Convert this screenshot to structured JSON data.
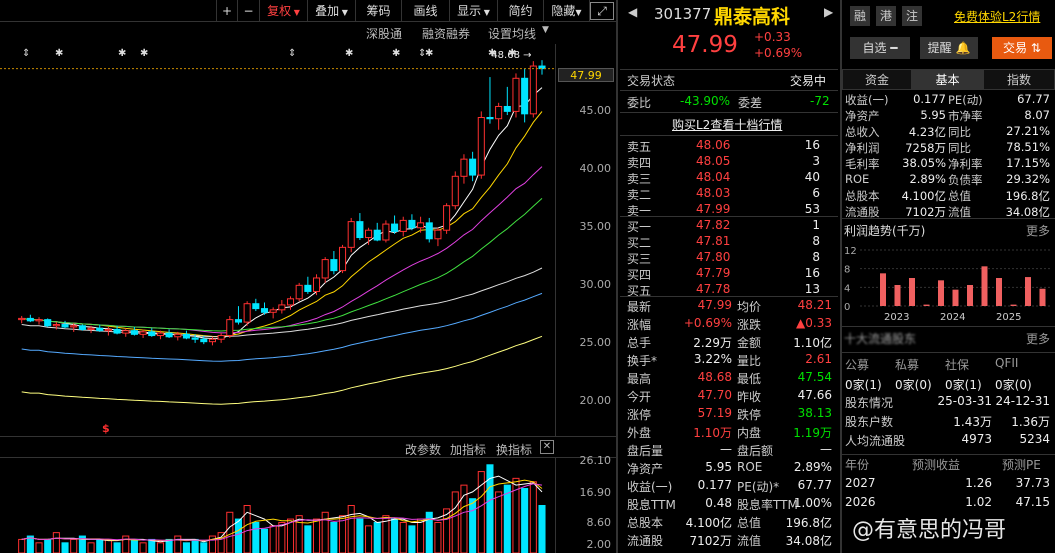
{
  "toolbar": {
    "plus": "+",
    "minus": "−",
    "fq": "复权",
    "overlay": "叠加",
    "chips": "筹码",
    "draw": "画线",
    "show": "显示",
    "simple": "简约",
    "hide": "隐藏",
    "expand": "⤢"
  },
  "chart_tabs": {
    "sgt": "深股通",
    "rzrq": "融资融券",
    "setma": "设置均线"
  },
  "indicator_tabs": {
    "params": "改参数",
    "add": "加指标",
    "change": "换指标"
  },
  "price_axis": [
    "45.00",
    "40.00",
    "35.00",
    "30.00",
    "25.00",
    "20.00"
  ],
  "current_price_tag": "47.99",
  "high_marker": "48.68",
  "vol_axis": [
    "26.10",
    "16.90",
    "8.60",
    "2.00"
  ],
  "header": {
    "code": "301377",
    "name": "鼎泰高科",
    "price": "47.99",
    "change": "+0.33",
    "pct": "+0.69%",
    "tags": [
      "融",
      "港",
      "注"
    ],
    "l2_link": "免费体验L2行情",
    "zixuan": "自选",
    "remind": "提醒",
    "trade": "交易"
  },
  "status": {
    "label": "交易状态",
    "value": "交易中"
  },
  "weibi": {
    "label": "委比",
    "value": "-43.90%",
    "label2": "委差",
    "value2": "-72"
  },
  "l2_buy": "购买L2查看十档行情",
  "asks": [
    {
      "n": "卖五",
      "p": "48.06",
      "v": "16"
    },
    {
      "n": "卖四",
      "p": "48.05",
      "v": "3"
    },
    {
      "n": "卖三",
      "p": "48.04",
      "v": "40"
    },
    {
      "n": "卖二",
      "p": "48.03",
      "v": "6"
    },
    {
      "n": "卖一",
      "p": "47.99",
      "v": "53"
    }
  ],
  "bids": [
    {
      "n": "买一",
      "p": "47.82",
      "v": "1"
    },
    {
      "n": "买二",
      "p": "47.81",
      "v": "8"
    },
    {
      "n": "买三",
      "p": "47.80",
      "v": "8"
    },
    {
      "n": "买四",
      "p": "47.79",
      "v": "16"
    },
    {
      "n": "买五",
      "p": "47.78",
      "v": "13"
    }
  ],
  "quote": [
    [
      "最新",
      "47.99",
      "均价",
      "48.21"
    ],
    [
      "涨幅",
      "+0.69%",
      "涨跌",
      "▲0.33"
    ],
    [
      "总手",
      "2.29万",
      "金额",
      "1.10亿"
    ],
    [
      "换手*",
      "3.22%",
      "量比",
      "2.61"
    ],
    [
      "最高",
      "48.68",
      "最低",
      "47.54"
    ],
    [
      "今开",
      "47.70",
      "昨收",
      "47.66"
    ],
    [
      "涨停",
      "57.19",
      "跌停",
      "38.13"
    ],
    [
      "外盘",
      "1.10万",
      "内盘",
      "1.19万"
    ],
    [
      "盘后量",
      "—",
      "盘后额",
      "—"
    ],
    [
      "净资产",
      "5.95",
      "ROE",
      "2.89%"
    ],
    [
      "收益(一)",
      "0.177",
      "PE(动)*",
      "67.77"
    ],
    [
      "股息TTM",
      "0.48",
      "股息率TTM",
      "1.00%"
    ],
    [
      "总股本",
      "4.100亿",
      "总值",
      "196.8亿"
    ],
    [
      "流通股",
      "7102万",
      "流值",
      "34.08亿"
    ]
  ],
  "rtabs": [
    "资金",
    "基本",
    "指数"
  ],
  "fund": [
    [
      "收益(一)",
      "0.177",
      "PE(动)",
      "67.77"
    ],
    [
      "净资产",
      "5.95",
      "市净率",
      "8.07"
    ],
    [
      "总收入",
      "4.23亿",
      "同比",
      "27.21%"
    ],
    [
      "净利润",
      "7258万",
      "同比",
      "78.51%"
    ],
    [
      "毛利率",
      "38.05%",
      "净利率",
      "17.15%"
    ],
    [
      "ROE",
      "2.89%",
      "负债率",
      "29.32%"
    ],
    [
      "总股本",
      "4.100亿",
      "总值",
      "196.8亿"
    ],
    [
      "流通股",
      "7102万",
      "流值",
      "34.08亿"
    ]
  ],
  "profit": {
    "title": "利润趋势(千万)",
    "more": "更多",
    "yticks": [
      "12",
      "8",
      "4",
      "0"
    ],
    "years": [
      "2023",
      "2024",
      "2025"
    ],
    "values": [
      7,
      4.5,
      6,
      0.3,
      5.5,
      3.5,
      4.5,
      8.5,
      6,
      0.3,
      6.2,
      3.7
    ]
  },
  "holders": {
    "title": "十大流通股东",
    "more": "更多",
    "cols": [
      "公募",
      "私募",
      "社保",
      "QFII"
    ],
    "vals": [
      "0家(1)",
      "0家(0)",
      "0家(1)",
      "0家(0)"
    ],
    "rows": [
      [
        "股东情况",
        "25-03-31",
        "24-12-31"
      ],
      [
        "股东户数",
        "1.43万",
        "1.36万"
      ],
      [
        "人均流通股",
        "4973",
        "5234"
      ]
    ]
  },
  "forecast": {
    "cols": [
      "年份",
      "预测收益",
      "预测PE"
    ],
    "rows": [
      [
        "2027",
        "1.26",
        "37.73"
      ],
      [
        "2026",
        "1.02",
        "47.15"
      ]
    ]
  },
  "watermark": "@有意思的冯哥",
  "chart_data": {
    "type": "candlestick",
    "ylim": [
      18,
      50
    ],
    "last_price": 47.99,
    "high": 48.68,
    "candles": [
      [
        27.5,
        27.8,
        27.2,
        27.6
      ],
      [
        27.6,
        27.9,
        27.3,
        27.4
      ],
      [
        27.4,
        27.7,
        27.1,
        27.5
      ],
      [
        27.5,
        27.6,
        26.9,
        27.0
      ],
      [
        27.0,
        27.3,
        26.7,
        27.1
      ],
      [
        27.1,
        27.4,
        26.8,
        26.9
      ],
      [
        26.9,
        27.2,
        26.5,
        27.0
      ],
      [
        27.0,
        27.1,
        26.6,
        26.7
      ],
      [
        26.7,
        27.0,
        26.4,
        26.8
      ],
      [
        26.8,
        27.1,
        26.5,
        26.6
      ],
      [
        26.6,
        26.9,
        26.2,
        26.7
      ],
      [
        26.7,
        27.0,
        26.3,
        26.4
      ],
      [
        26.4,
        26.8,
        26.1,
        26.6
      ],
      [
        26.6,
        26.9,
        26.2,
        26.3
      ],
      [
        26.3,
        26.7,
        26.0,
        26.5
      ],
      [
        26.5,
        26.8,
        26.1,
        26.2
      ],
      [
        26.2,
        26.6,
        25.9,
        26.4
      ],
      [
        26.4,
        26.7,
        26.0,
        26.1
      ],
      [
        26.1,
        26.5,
        25.8,
        26.3
      ],
      [
        26.3,
        26.6,
        25.9,
        26.0
      ],
      [
        26.0,
        26.3,
        25.6,
        25.9
      ],
      [
        25.9,
        26.2,
        25.5,
        25.7
      ],
      [
        25.7,
        26.1,
        25.4,
        25.9
      ],
      [
        25.9,
        26.4,
        25.6,
        26.2
      ],
      [
        26.2,
        27.8,
        26.0,
        27.5
      ],
      [
        27.5,
        28.6,
        27.1,
        27.3
      ],
      [
        27.3,
        29.0,
        27.0,
        28.8
      ],
      [
        28.8,
        29.2,
        28.2,
        28.4
      ],
      [
        28.4,
        28.9,
        27.9,
        28.1
      ],
      [
        28.1,
        28.5,
        27.6,
        28.3
      ],
      [
        28.3,
        29.1,
        28.0,
        28.7
      ],
      [
        28.7,
        29.4,
        28.3,
        29.2
      ],
      [
        29.2,
        30.5,
        29.0,
        30.3
      ],
      [
        30.3,
        31.0,
        29.6,
        29.8
      ],
      [
        29.8,
        31.2,
        29.5,
        30.9
      ],
      [
        30.9,
        32.6,
        30.5,
        32.4
      ],
      [
        32.4,
        33.1,
        31.2,
        31.5
      ],
      [
        31.5,
        33.6,
        31.3,
        33.4
      ],
      [
        33.4,
        35.8,
        33.0,
        35.5
      ],
      [
        35.5,
        36.2,
        34.0,
        34.2
      ],
      [
        34.2,
        35.0,
        33.6,
        34.8
      ],
      [
        34.8,
        35.4,
        33.9,
        34.0
      ],
      [
        34.0,
        35.6,
        33.8,
        35.3
      ],
      [
        35.3,
        36.0,
        34.5,
        34.7
      ],
      [
        34.7,
        35.9,
        34.3,
        35.6
      ],
      [
        35.6,
        36.1,
        34.8,
        35.0
      ],
      [
        35.0,
        35.9,
        34.6,
        35.4
      ],
      [
        35.4,
        35.8,
        33.8,
        34.1
      ],
      [
        34.1,
        35.0,
        33.5,
        34.8
      ],
      [
        34.8,
        37.0,
        34.5,
        36.8
      ],
      [
        36.8,
        39.6,
        36.5,
        39.2
      ],
      [
        39.2,
        41.0,
        38.6,
        40.6
      ],
      [
        40.6,
        41.2,
        38.8,
        39.3
      ],
      [
        39.3,
        44.5,
        39.0,
        44.0
      ],
      [
        44.0,
        47.3,
        43.5,
        43.9
      ],
      [
        43.9,
        45.2,
        43.0,
        44.9
      ],
      [
        44.9,
        46.5,
        44.2,
        44.5
      ],
      [
        44.5,
        47.6,
        44.0,
        47.2
      ],
      [
        47.2,
        48.0,
        43.6,
        44.3
      ],
      [
        44.3,
        48.6,
        44.0,
        48.2
      ],
      [
        48.2,
        48.68,
        47.5,
        47.99
      ]
    ],
    "volume": [
      4,
      5,
      3,
      4,
      6,
      3,
      4,
      5,
      3,
      4,
      4,
      3,
      5,
      4,
      3,
      4,
      3,
      4,
      5,
      3,
      4,
      3,
      5,
      6,
      12,
      10,
      14,
      9,
      7,
      8,
      9,
      10,
      11,
      8,
      10,
      12,
      9,
      11,
      14,
      10,
      8,
      9,
      11,
      10,
      9,
      8,
      10,
      12,
      9,
      13,
      18,
      20,
      16,
      24,
      26,
      18,
      20,
      22,
      19,
      21,
      14
    ],
    "vol_ylim": [
      0,
      28
    ]
  }
}
